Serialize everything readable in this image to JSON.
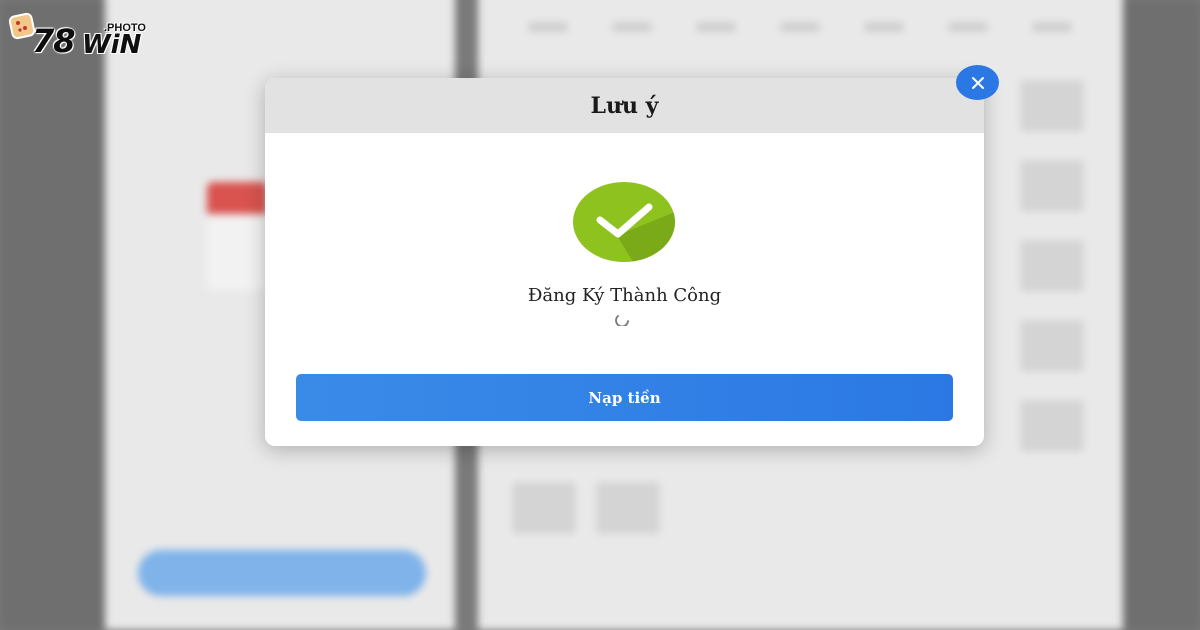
{
  "logo": {
    "number": "78",
    "word": "WiN",
    "tld": ".PHOTO"
  },
  "modal": {
    "title": "Lưu ý",
    "message": "Đăng Ký Thành Công",
    "deposit_button_label": "Nạp tiền",
    "close_icon": "close-icon",
    "success_icon": "checkmark-icon",
    "loading_icon": "spinner-icon"
  },
  "colors": {
    "accent_blue": "#2b78e4",
    "success_green": "#8dc21f",
    "header_gray": "#e2e2e2"
  }
}
